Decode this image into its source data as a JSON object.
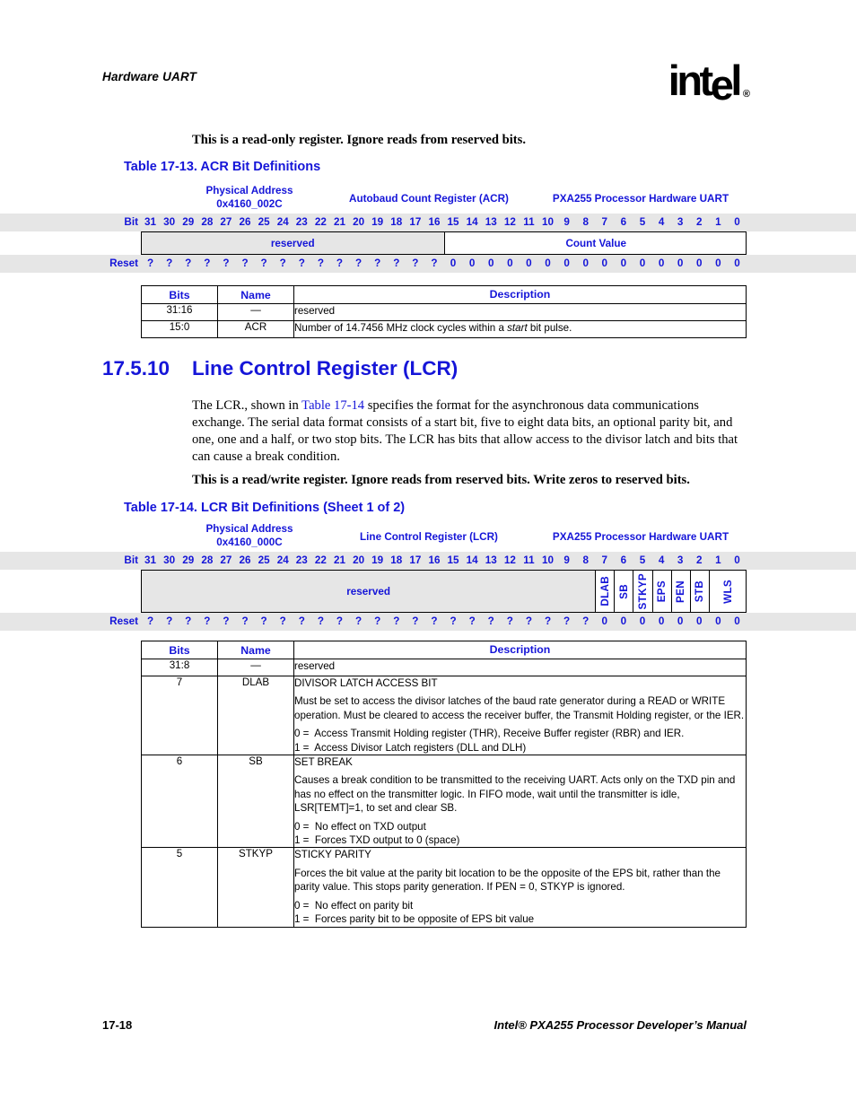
{
  "header": {
    "chapter_title": "Hardware UART",
    "logo_text": "intel",
    "logo_registered": "®"
  },
  "notes": {
    "acr_note": "This is a read-only register. Ignore reads from reserved bits.",
    "lcr_note": "This is a read/write register. Ignore reads from reserved bits. Write zeros to reserved bits."
  },
  "acr_table": {
    "title": "Table 17-13. ACR Bit Definitions",
    "physical_address_label": "Physical Address",
    "physical_address_value": "0x4160_002C",
    "register_name": "Autobaud Count Register (ACR)",
    "unit_name": "PXA255 Processor Hardware UART",
    "bit_row_label": "Bit",
    "reset_row_label": "Reset",
    "bit_numbers": [
      "31",
      "30",
      "29",
      "28",
      "27",
      "26",
      "25",
      "24",
      "23",
      "22",
      "21",
      "20",
      "19",
      "18",
      "17",
      "16",
      "15",
      "14",
      "13",
      "12",
      "11",
      "10",
      "9",
      "8",
      "7",
      "6",
      "5",
      "4",
      "3",
      "2",
      "1",
      "0"
    ],
    "reset_values": [
      "?",
      "?",
      "?",
      "?",
      "?",
      "?",
      "?",
      "?",
      "?",
      "?",
      "?",
      "?",
      "?",
      "?",
      "?",
      "?",
      "0",
      "0",
      "0",
      "0",
      "0",
      "0",
      "0",
      "0",
      "0",
      "0",
      "0",
      "0",
      "0",
      "0",
      "0",
      "0"
    ],
    "fields": [
      {
        "label": "reserved",
        "msb": 31,
        "lsb": 16,
        "reserved": true,
        "vertical": false
      },
      {
        "label": "Count Value",
        "msb": 15,
        "lsb": 0,
        "reserved": false,
        "vertical": false
      }
    ],
    "columns": {
      "bits": "Bits",
      "name": "Name",
      "description": "Description"
    },
    "rows": [
      {
        "bits": "31:16",
        "name": "—",
        "desc_plain": "reserved"
      },
      {
        "bits": "15:0",
        "name": "ACR",
        "desc_plain": "Number of 14.7456 MHz clock cycles within a start bit pulse."
      }
    ]
  },
  "section": {
    "number": "17.5.10",
    "title": "Line Control Register (LCR)",
    "paragraph_part1": "The LCR., shown in ",
    "paragraph_xref": "Table 17-14",
    "paragraph_part2": " specifies the format for the asynchronous data communications exchange. The serial data format consists of a start bit, five to eight data bits, an optional parity bit, and one, one and a half, or two stop bits. The LCR has bits that allow access to the divisor latch and bits that can cause a break condition."
  },
  "lcr_table": {
    "title": "Table 17-14. LCR Bit Definitions (Sheet 1 of 2)",
    "physical_address_label": "Physical Address",
    "physical_address_value": "0x4160_000C",
    "register_name": "Line Control Register (LCR)",
    "unit_name": "PXA255 Processor Hardware UART",
    "bit_row_label": "Bit",
    "reset_row_label": "Reset",
    "bit_numbers": [
      "31",
      "30",
      "29",
      "28",
      "27",
      "26",
      "25",
      "24",
      "23",
      "22",
      "21",
      "20",
      "19",
      "18",
      "17",
      "16",
      "15",
      "14",
      "13",
      "12",
      "11",
      "10",
      "9",
      "8",
      "7",
      "6",
      "5",
      "4",
      "3",
      "2",
      "1",
      "0"
    ],
    "reset_values": [
      "?",
      "?",
      "?",
      "?",
      "?",
      "?",
      "?",
      "?",
      "?",
      "?",
      "?",
      "?",
      "?",
      "?",
      "?",
      "?",
      "?",
      "?",
      "?",
      "?",
      "?",
      "?",
      "?",
      "?",
      "0",
      "0",
      "0",
      "0",
      "0",
      "0",
      "0",
      "0"
    ],
    "fields": [
      {
        "label": "reserved",
        "msb": 31,
        "lsb": 8,
        "reserved": true,
        "vertical": false
      },
      {
        "label": "DLAB",
        "msb": 7,
        "lsb": 7,
        "reserved": false,
        "vertical": true
      },
      {
        "label": "SB",
        "msb": 6,
        "lsb": 6,
        "reserved": false,
        "vertical": true
      },
      {
        "label": "STKYP",
        "msb": 5,
        "lsb": 5,
        "reserved": false,
        "vertical": true
      },
      {
        "label": "EPS",
        "msb": 4,
        "lsb": 4,
        "reserved": false,
        "vertical": true
      },
      {
        "label": "PEN",
        "msb": 3,
        "lsb": 3,
        "reserved": false,
        "vertical": true
      },
      {
        "label": "STB",
        "msb": 2,
        "lsb": 2,
        "reserved": false,
        "vertical": true
      },
      {
        "label": "WLS",
        "msb": 1,
        "lsb": 0,
        "reserved": false,
        "vertical": true
      }
    ],
    "columns": {
      "bits": "Bits",
      "name": "Name",
      "description": "Description"
    },
    "rows": [
      {
        "bits": "31:8",
        "name": "—",
        "heading": "",
        "body": "reserved",
        "zero_line": "",
        "one_line": ""
      },
      {
        "bits": "7",
        "name": "DLAB",
        "heading": "DIVISOR LATCH ACCESS BIT",
        "body": "Must be set to access the divisor latches of the baud rate generator during a READ or WRITE operation. Must be cleared to access the receiver buffer, the Transmit Holding register, or the IER.",
        "zero_line": "0 =  Access Transmit Holding register (THR), Receive Buffer register (RBR) and IER.",
        "one_line": "1 =  Access Divisor Latch registers (DLL and DLH)"
      },
      {
        "bits": "6",
        "name": "SB",
        "heading": "SET BREAK",
        "body": "Causes a break condition to be transmitted to the receiving UART. Acts only on the TXD pin and has no effect on the transmitter logic. In FIFO mode, wait until the transmitter is idle, LSR[TEMT]=1, to set and clear SB.",
        "zero_line": "0 =  No effect on TXD output",
        "one_line": "1 =  Forces TXD output to 0 (space)"
      },
      {
        "bits": "5",
        "name": "STKYP",
        "heading": "STICKY PARITY",
        "body": "Forces the bit value at the parity bit location to be the opposite of the EPS bit, rather than the parity value. This stops parity generation. If PEN = 0, STKYP is ignored.",
        "zero_line": "0 =  No effect on parity bit",
        "one_line": "1 =  Forces parity bit to be opposite of EPS bit value"
      }
    ]
  },
  "footer": {
    "page_number": "17-18",
    "manual_title_pre": "Intel",
    "manual_title_reg": "®",
    "manual_title_post": " PXA255 Processor Developer’s Manual"
  },
  "colors": {
    "accent_blue": "#1515d8",
    "band_gray": "#e6e6e6",
    "rule_black": "#000000"
  }
}
